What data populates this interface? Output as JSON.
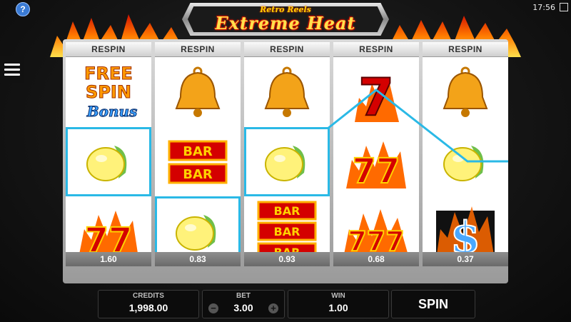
{
  "header": {
    "help_label": "?",
    "clock": "17:56",
    "logo_line1": "Retro Reels",
    "logo_line2": "Extreme Heat"
  },
  "reels": [
    {
      "header": "RESPIN",
      "multiplier": "1.60",
      "symbols": [
        "free-spin-bonus",
        "lemon",
        "double-seven-flame"
      ]
    },
    {
      "header": "RESPIN",
      "multiplier": "0.83",
      "symbols": [
        "bell",
        "double-bar",
        "lemon"
      ]
    },
    {
      "header": "RESPIN",
      "multiplier": "0.93",
      "symbols": [
        "bell",
        "lemon",
        "triple-bar"
      ]
    },
    {
      "header": "RESPIN",
      "multiplier": "0.68",
      "symbols": [
        "seven",
        "double-seven-flame",
        "triple-seven-flame"
      ]
    },
    {
      "header": "RESPIN",
      "multiplier": "0.37",
      "symbols": [
        "bell",
        "lemon",
        "dollar-flame"
      ]
    }
  ],
  "symbol_text": {
    "free_spin_line1": "FREE",
    "free_spin_line2": "SPIN",
    "bonus": "Bonus",
    "bar": "BAR",
    "seven": "7",
    "double_seven": "77",
    "triple_seven": "777",
    "dollar": "$"
  },
  "bottom_bar": {
    "credits_label": "CREDITS",
    "credits_value": "1,998.00",
    "bet_label": "BET",
    "bet_value": "3.00",
    "bet_minus": "−",
    "bet_plus": "+",
    "win_label": "WIN",
    "win_value": "1.00",
    "spin_label": "SPIN"
  },
  "colors": {
    "highlight": "#2ab9e6",
    "flame": "#ff5a00"
  }
}
